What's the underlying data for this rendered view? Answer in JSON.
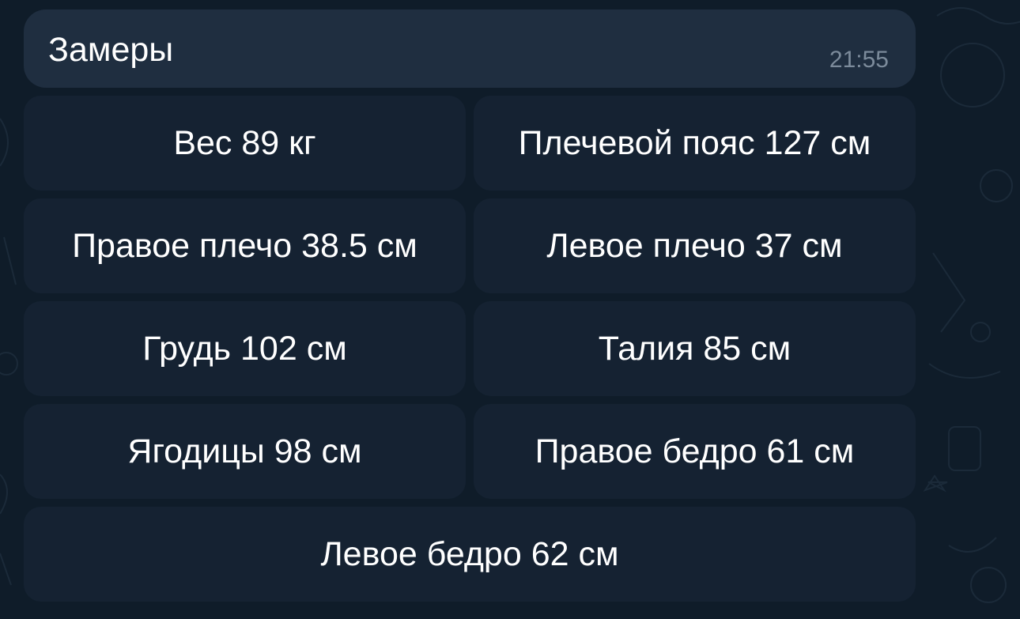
{
  "message": {
    "text": "Замеры",
    "time": "21:55"
  },
  "keyboard": {
    "rows": [
      [
        "Вес 89 кг",
        "Плечевой пояс 127 см"
      ],
      [
        "Правое плечо 38.5 см",
        "Левое плечо 37 см"
      ],
      [
        "Грудь 102 см",
        "Талия 85 см"
      ],
      [
        "Ягодицы 98 см",
        "Правое бедро 61 см"
      ],
      [
        "Левое бедро 62 см"
      ]
    ]
  },
  "colors": {
    "background": "#0f1c29",
    "bubble": "#1f2e40",
    "time": "#7c8b9b",
    "button": "#182636"
  }
}
